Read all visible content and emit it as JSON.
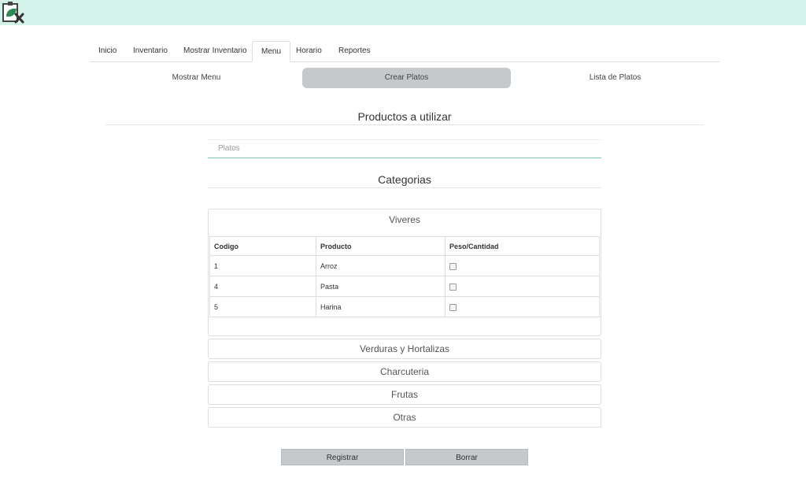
{
  "app": {
    "logo_icon": "app-logo-icon",
    "topbar_color": "#d3f2e9"
  },
  "nav": {
    "tabs": [
      {
        "label": "Inicio"
      },
      {
        "label": "Inventario"
      },
      {
        "label": "Mostrar Inventario"
      },
      {
        "label": "Menu",
        "active": true
      },
      {
        "label": "Horario"
      },
      {
        "label": "Reportes"
      }
    ]
  },
  "subnav": {
    "items": [
      {
        "label": "Mostrar Menu"
      },
      {
        "label": "Crear Platos",
        "active": true
      },
      {
        "label": "Lista de Platos"
      }
    ]
  },
  "form": {
    "title": "Productos a utilizar",
    "platos_placeholder": "Platos",
    "platos_value": "",
    "categories_title": "Categorias"
  },
  "categories": {
    "expanded": {
      "title": "Viveres",
      "columns": [
        "Codigo",
        "Producto",
        "Peso/Cantidad"
      ],
      "rows": [
        {
          "codigo": "1",
          "producto": "Arroz",
          "checked": false
        },
        {
          "codigo": "4",
          "producto": "Pasta",
          "checked": false
        },
        {
          "codigo": "5",
          "producto": "Harina",
          "checked": false
        }
      ]
    },
    "collapsed": [
      "Verduras y Hortalizas",
      "Charcuteria",
      "Frutas",
      "Otras"
    ]
  },
  "actions": {
    "register": "Registrar",
    "clear": "Borrar"
  },
  "colors": {
    "accent_line": "#7cc5b7",
    "button_bg": "#c6c9cc"
  }
}
